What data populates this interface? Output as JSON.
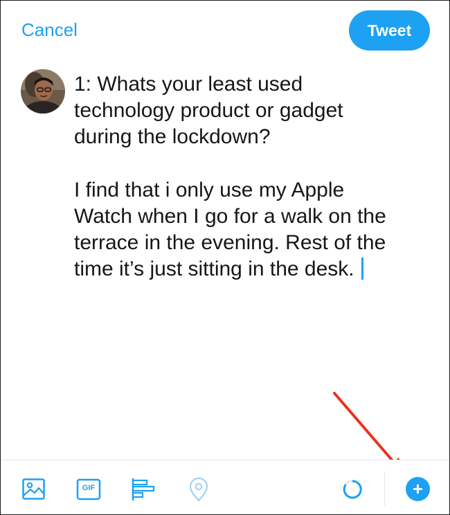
{
  "header": {
    "cancel_label": "Cancel",
    "tweet_label": "Tweet"
  },
  "compose": {
    "text": "1: Whats your least used\ntechnology product or gadget\nduring the lockdown?\n\nI find that i only use my Apple\nWatch when I go for a walk on the\nterrace in the evening. Rest of the\ntime it’s just sitting in the desk."
  },
  "toolbar": {
    "gif_label": "GIF",
    "add_label": "+",
    "icons": [
      "image-icon",
      "gif-icon",
      "poll-icon",
      "location-icon",
      "character-count-icon",
      "add-tweet-icon"
    ]
  },
  "colors": {
    "accent": "#1da1f2",
    "arrow": "#e8321f",
    "text": "#14171a"
  }
}
